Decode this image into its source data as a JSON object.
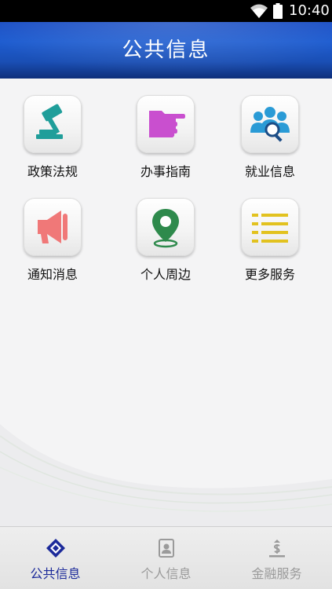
{
  "status_bar": {
    "time": "10:40",
    "wifi_icon": "wifi-icon",
    "battery_icon": "battery-icon"
  },
  "header": {
    "title": "公共信息"
  },
  "grid": {
    "items": [
      {
        "label": "政策法规",
        "icon": "gavel-icon",
        "color": "#1f9e9a"
      },
      {
        "label": "办事指南",
        "icon": "pointing-hand-icon",
        "color": "#c94fcf"
      },
      {
        "label": "就业信息",
        "icon": "people-search-icon",
        "color": "#2a9bd6"
      },
      {
        "label": "通知消息",
        "icon": "megaphone-icon",
        "color": "#f07878"
      },
      {
        "label": "个人周边",
        "icon": "location-pin-icon",
        "color": "#2e8a4c"
      },
      {
        "label": "更多服务",
        "icon": "list-icon",
        "color": "#e2c21f"
      }
    ]
  },
  "tabbar": {
    "tabs": [
      {
        "label": "公共信息",
        "icon": "diamond-icon",
        "active": true
      },
      {
        "label": "个人信息",
        "icon": "id-card-icon",
        "active": false
      },
      {
        "label": "金融服务",
        "icon": "finance-icon",
        "active": false
      }
    ],
    "active_color": "#1c2a9a",
    "inactive_color": "#9a9a9a"
  }
}
